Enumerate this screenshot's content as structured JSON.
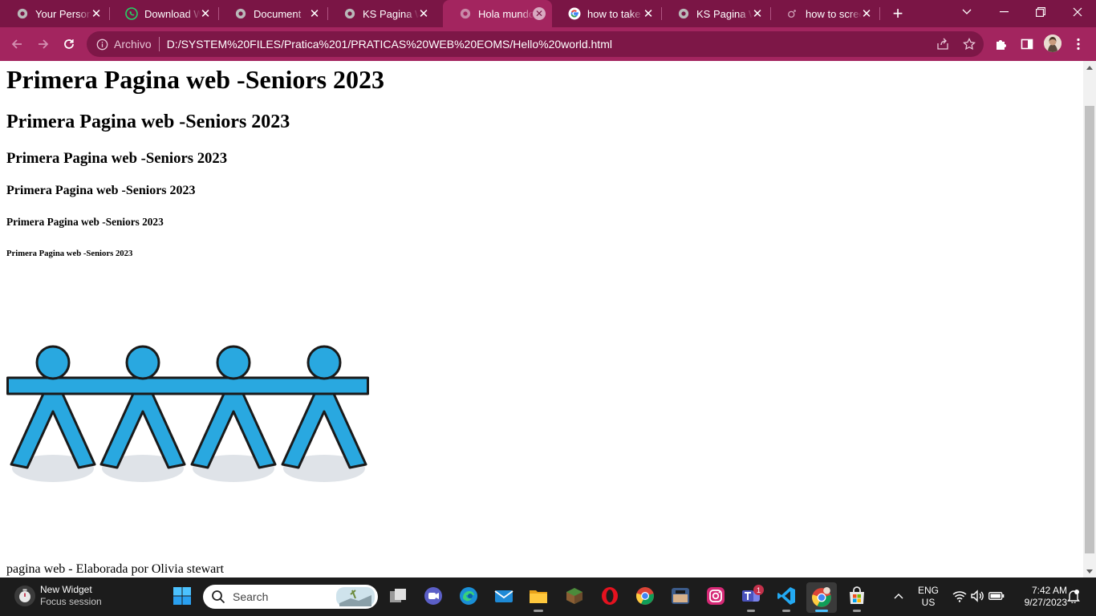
{
  "browser": {
    "tabs": [
      {
        "title": "Your Persona",
        "favicon": "globe-icon"
      },
      {
        "title": "Download W",
        "favicon": "whatsapp-icon"
      },
      {
        "title": "Document",
        "favicon": "globe-icon"
      },
      {
        "title": "KS Pagina W",
        "favicon": "globe-icon"
      },
      {
        "title": "Hola mundo",
        "favicon": "globe-icon",
        "active": true
      },
      {
        "title": "how to take",
        "favicon": "google-icon"
      },
      {
        "title": "KS Pagina W",
        "favicon": "globe-icon"
      },
      {
        "title": "how to scree",
        "favicon": "loading-icon"
      }
    ],
    "address_scheme_label": "Archivo",
    "address_url": "D:/SYSTEM%20FILES/Pratica%201/PRATICAS%20WEB%20EOMS/Hello%20world.html",
    "colors": {
      "frame": "#7a1545",
      "toolbar": "#a3255f",
      "omnibox": "#7d1747"
    }
  },
  "page": {
    "headings": {
      "h1": "Primera Pagina web -Seniors 2023",
      "h2": "Primera Pagina web -Seniors 2023",
      "h3": "Primera Pagina web -Seniors 2023",
      "h4": "Primera Pagina web -Seniors 2023",
      "h5": "Primera Pagina web -Seniors 2023",
      "h6": "Primera Pagina web -Seniors 2023"
    },
    "image": {
      "subject": "four blue figures holding hands",
      "color": "#29a8e0"
    },
    "footer": "pagina web - Elaborada por Olivia stewart"
  },
  "taskbar": {
    "widget_title": "New Widget",
    "widget_subtitle": "Focus session",
    "search_placeholder": "Search",
    "teams_badge": "1",
    "language": "ENG",
    "region": "US",
    "time": "7:42 AM",
    "date": "9/27/2023"
  }
}
